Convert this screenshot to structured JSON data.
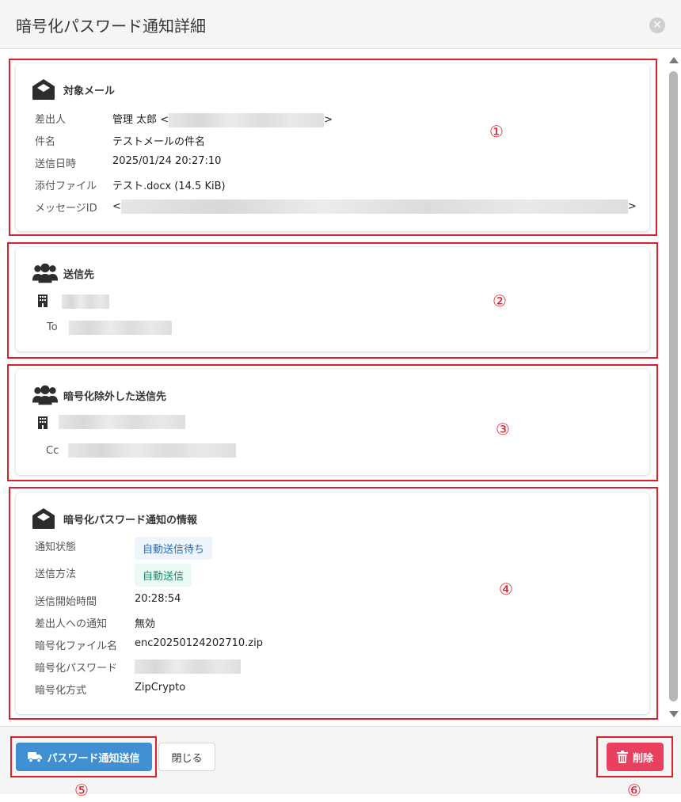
{
  "modal": {
    "title": "暗号化パスワード通知詳細",
    "close_icon": "close-icon"
  },
  "target_mail": {
    "title": "対象メール",
    "icon": "envelope-open-icon",
    "rows": [
      {
        "label": "差出人",
        "value_prefix": "管理 太郎 <",
        "value_suffix": ">"
      },
      {
        "label": "件名",
        "value": "テストメールの件名"
      },
      {
        "label": "送信日時",
        "value": "2025/01/24 20:27:10"
      },
      {
        "label": "添付ファイル",
        "value": "テスト.docx (14.5 KiB)"
      },
      {
        "label": "メッセージID",
        "value_prefix": "<",
        "value_suffix": ">"
      }
    ]
  },
  "recipients": {
    "title": "送信先",
    "icon": "users-icon",
    "org_icon": "building-icon",
    "to_label": "To"
  },
  "excluded": {
    "title": "暗号化除外した送信先",
    "icon": "users-icon",
    "org_icon": "building-icon",
    "cc_label": "Cc"
  },
  "notification": {
    "title": "暗号化パスワード通知の情報",
    "icon": "envelope-open-icon",
    "rows": [
      {
        "label": "通知状態",
        "value": "自動送信待ち"
      },
      {
        "label": "送信方法",
        "value": "自動送信"
      },
      {
        "label": "送信開始時間",
        "value": "20:28:54"
      },
      {
        "label": "差出人への通知",
        "value": "無効"
      },
      {
        "label": "暗号化ファイル名",
        "value": "enc20250124202710.zip"
      },
      {
        "label": "暗号化パスワード",
        "value": ""
      },
      {
        "label": "暗号化方式",
        "value": "ZipCrypto"
      }
    ]
  },
  "footer": {
    "send_label": "パスワード通知送信",
    "send_icon": "truck-icon",
    "close_label": "閉じる",
    "delete_label": "削除",
    "delete_icon": "trash-icon"
  },
  "annotations": {
    "m1": "①",
    "m2": "②",
    "m3": "③",
    "m4": "④",
    "m5": "⑤",
    "m6": "⑥"
  },
  "colors": {
    "annotation_red": "#d9202b",
    "primary": "#3f8fd2",
    "danger": "#e8405e",
    "tag_info_text": "#2b6cb0",
    "tag_success_text": "#1f8a66"
  }
}
